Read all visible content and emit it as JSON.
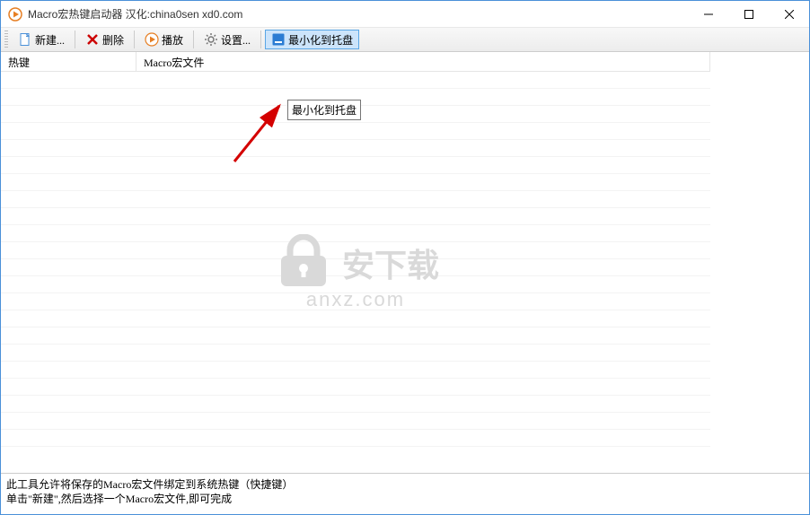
{
  "title": "Macro宏热键启动器 汉化:china0sen xd0.com",
  "toolbar": {
    "new_label": "新建...",
    "delete_label": "删除",
    "play_label": "播放",
    "settings_label": "设置...",
    "minimize_label": "最小化到托盘"
  },
  "columns": {
    "hotkey": "热键",
    "macrofile": "Macro宏文件"
  },
  "tooltip": "最小化到托盘",
  "help": {
    "line1": "此工具允许将保存的Macro宏文件绑定到系统热键（快捷键）",
    "line2": "单击\"新建\",然后选择一个Macro宏文件,即可完成"
  },
  "watermark": {
    "cn": "安下载",
    "url": "anxz.com"
  }
}
